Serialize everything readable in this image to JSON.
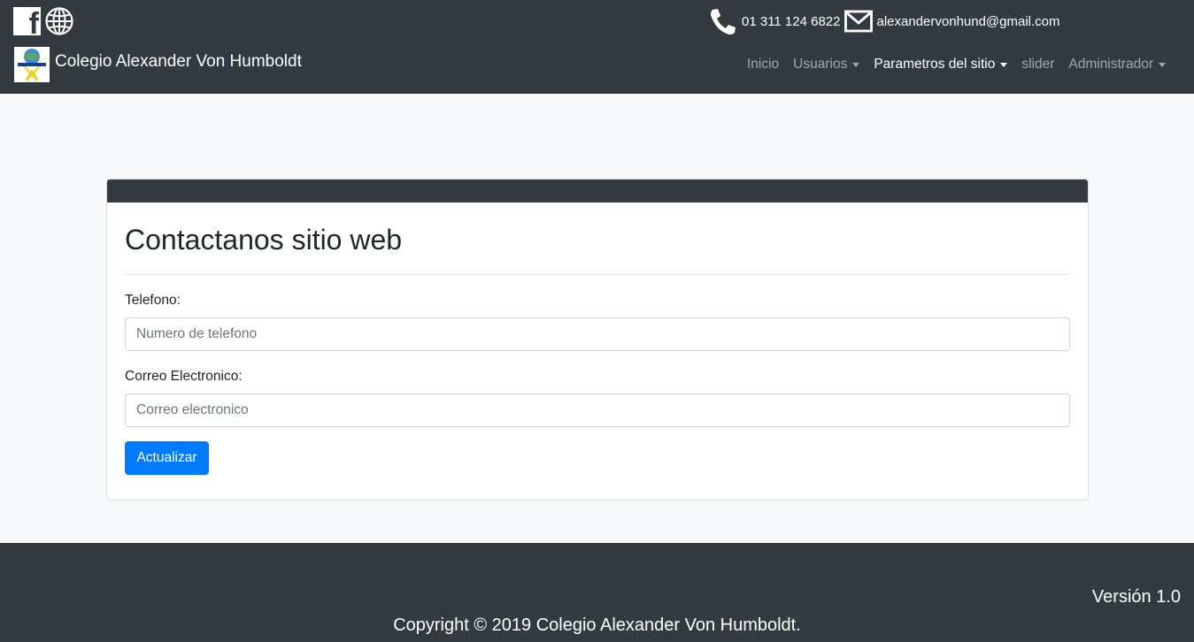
{
  "header": {
    "phone": "01 311 124 6822",
    "email": "alexandervonhund@gmail.com",
    "brand_title": "Colegio Alexander Von Humboldt",
    "social_icons": [
      "facebook-icon",
      "globe-icon"
    ]
  },
  "nav": {
    "items": [
      {
        "label": "Inicio",
        "dropdown": false,
        "active": false
      },
      {
        "label": "Usuarios",
        "dropdown": true,
        "active": false
      },
      {
        "label": "Parametros del sitio",
        "dropdown": true,
        "active": true
      },
      {
        "label": "slider",
        "dropdown": false,
        "active": false
      },
      {
        "label": "Administrador",
        "dropdown": true,
        "active": false
      }
    ]
  },
  "form": {
    "title": "Contactanos sitio web",
    "phone_label": "Telefono:",
    "phone_placeholder": "Numero de telefono",
    "email_label": "Correo Electronico:",
    "email_placeholder": "Correo electronico",
    "submit_label": "Actualizar"
  },
  "footer": {
    "version": "Versión 1.0",
    "copyright": "Copyright © 2019 Colegio Alexander Von Humboldt."
  },
  "colors": {
    "dark": "#343a40",
    "primary": "#007bff",
    "background": "#f8f9fa"
  }
}
